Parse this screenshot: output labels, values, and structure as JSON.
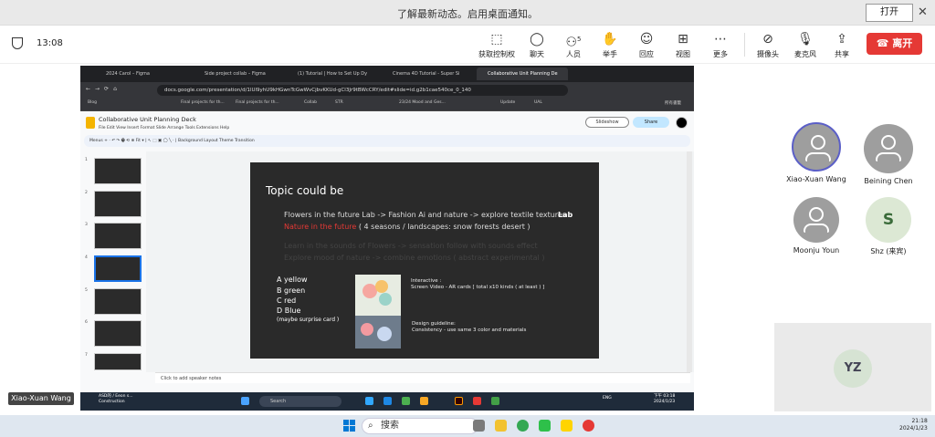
{
  "notification": {
    "text": "了解最新动态。启用桌面通知。",
    "open_label": "打开",
    "close_icon": "close-icon"
  },
  "meeting": {
    "time": "13:08",
    "toolbar": [
      {
        "label": "获取控制权",
        "icon": "control-icon"
      },
      {
        "label": "聊天",
        "icon": "chat-icon"
      },
      {
        "label": "人员",
        "icon": "people-icon",
        "badge": "5"
      },
      {
        "label": "举手",
        "icon": "hand-icon"
      },
      {
        "label": "回应",
        "icon": "emoji-icon"
      },
      {
        "label": "视图",
        "icon": "grid-icon"
      },
      {
        "label": "更多",
        "icon": "more-icon"
      },
      {
        "label": "摄像头",
        "icon": "camera-off-icon"
      },
      {
        "label": "麦克风",
        "icon": "mic-icon"
      },
      {
        "label": "共享",
        "icon": "share-icon"
      }
    ],
    "leave_label": "离开",
    "participants": [
      {
        "name": "Xiao-Xuan Wang"
      },
      {
        "name": "Beining Chen"
      },
      {
        "name": "Moonju Youn"
      },
      {
        "name": "Shz (来宾)",
        "initial": "S"
      }
    ],
    "self_initials": "YZ",
    "presenter_label": "Xiao-Xuan Wang"
  },
  "browser": {
    "tabs": [
      "2024 Carol – Figma",
      "Side project collab – Figma",
      "(1) Tutorial | How to Set Up Dy",
      "Cinema 4D Tutorial - Super Si",
      "Collaborative Unit Planning De"
    ],
    "url": "docs.google.com/presentation/d/1lUl9yhU9kHGwnTcGwWvCjbvKKUd-gCl3Jr9tBWcCRY/edit#slide=id.g2b1cae540ce_0_140",
    "bookmarks": [
      "Blog",
      "Final projects for th...",
      "Final projects for th...",
      "Collab",
      "STR",
      "23/24 Mood and Ges...",
      "Update",
      "UAL",
      "所有書籤"
    ]
  },
  "slides_app": {
    "title": "Collaborative Unit Planning Deck",
    "menus": "File  Edit  View  Insert  Format  Slide  Arrange  Tools  Extensions  Help",
    "toolbar": "Menus    +  ·  ↶  ↷  🖶  ⟲  ⊕  Fit   ▾   |  ↖  ⬚  ▣  ◯  ╲  ·   |  Background     Layout     Theme     Transition",
    "slideshow_label": "Slideshow",
    "share_label": "Share",
    "thumb_numbers": [
      "1",
      "2",
      "3",
      "4",
      "5",
      "6",
      "7"
    ],
    "speaker_notes": "Click to add speaker notes"
  },
  "slide": {
    "title": "Topic could be",
    "line1": "Flowers in the future Lab -> Fashion Ai and nature -> explore textile textures",
    "line1_bold": "Lab",
    "line2_red": "Nature in the future",
    "line2_rest": " ( 4 seasons / landscapes: snow forests desert )",
    "faint1": "Learn in the sounds of Flowers -> sensation follow with sounds effect",
    "faint2": "Explore mood of nature -> combine emotions ( abstract experimental )",
    "options": [
      "A yellow",
      "B green",
      "C red",
      "D Blue",
      "(maybe surprise card )"
    ],
    "interactive": "Interactive :",
    "interactive_detail": "Screen Video - AR cards  [ total x10 kinds ( at least ) ]",
    "design": "Design guideline:",
    "design_detail": "Consistency - use same 3 color and materials"
  },
  "remote_taskbar": {
    "left_line1": "ASD的 / Eeon s...",
    "left_line2": "Construction",
    "search": "Search",
    "lang": "ENG",
    "clock_time": "下午 03:18",
    "clock_date": "2024/1/23"
  },
  "local_taskbar": {
    "search": "搜索",
    "time": "21:18",
    "date": "2024/1/23"
  }
}
